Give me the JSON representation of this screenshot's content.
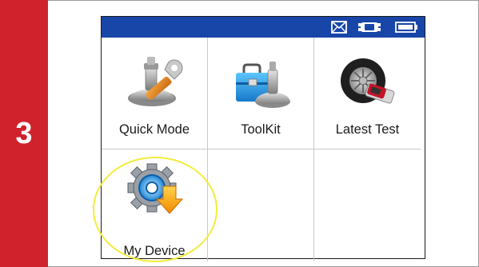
{
  "step": {
    "number": "3"
  },
  "status_bar": {
    "color": "#1845a8",
    "icons": [
      "mail-icon",
      "vehicle-icon",
      "battery-icon"
    ]
  },
  "menu": {
    "items": [
      {
        "label": "Quick Mode",
        "icon": "tpms-wrench-icon"
      },
      {
        "label": "ToolKit",
        "icon": "toolbox-icon"
      },
      {
        "label": "Latest Test",
        "icon": "tire-test-icon"
      },
      {
        "label": "My Device",
        "icon": "gear-download-icon"
      }
    ]
  },
  "colors": {
    "step_bar": "#d0222c",
    "highlight_circle": "#f2ec3c"
  }
}
